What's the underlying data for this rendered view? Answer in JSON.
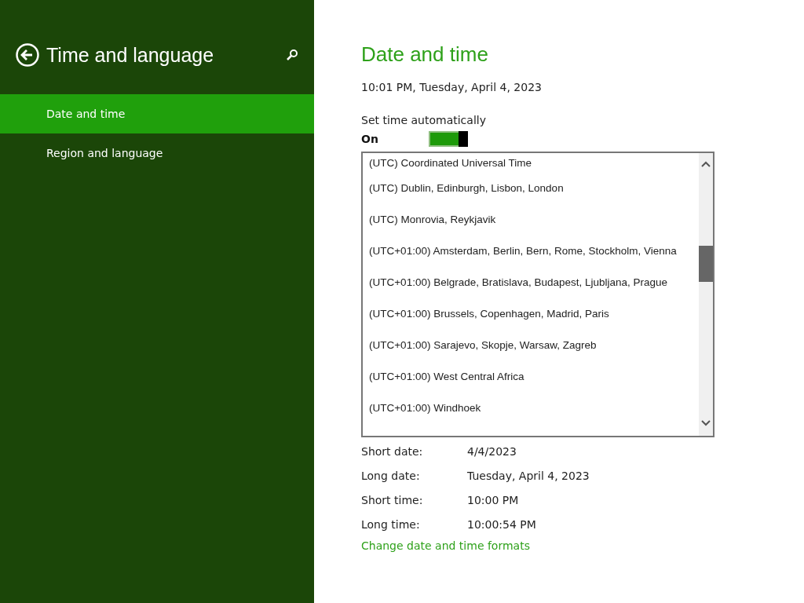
{
  "sidebar": {
    "title": "Time and language",
    "items": [
      {
        "label": "Date and time",
        "selected": true
      },
      {
        "label": "Region and language",
        "selected": false
      }
    ]
  },
  "main": {
    "title": "Date and time",
    "current": "10:01 PM, Tuesday, April 4, 2023",
    "auto_time": {
      "label": "Set time automatically",
      "state": "On",
      "on": true
    },
    "timezone_list": {
      "items": [
        {
          "label": "(UTC) Coordinated Universal Time"
        },
        {
          "label": "(UTC) Dublin, Edinburgh, Lisbon, London"
        },
        {
          "label": "(UTC) Monrovia, Reykjavik"
        },
        {
          "label": "(UTC+01:00) Amsterdam, Berlin, Bern, Rome, Stockholm, Vienna"
        },
        {
          "label": "(UTC+01:00) Belgrade, Bratislava, Budapest, Ljubljana, Prague"
        },
        {
          "label": "(UTC+01:00) Brussels, Copenhagen, Madrid, Paris"
        },
        {
          "label": "(UTC+01:00) Sarajevo, Skopje, Warsaw, Zagreb"
        },
        {
          "label": "(UTC+01:00) West Central Africa"
        },
        {
          "label": "(UTC+01:00) Windhoek"
        }
      ]
    },
    "formats": [
      {
        "label": "Short date:",
        "value": "4/4/2023"
      },
      {
        "label": "Long date:",
        "value": "Tuesday, April 4, 2023"
      },
      {
        "label": "Short time:",
        "value": "10:00 PM"
      },
      {
        "label": "Long time:",
        "value": "10:00:54 PM"
      }
    ],
    "link": "Change date and time formats"
  }
}
